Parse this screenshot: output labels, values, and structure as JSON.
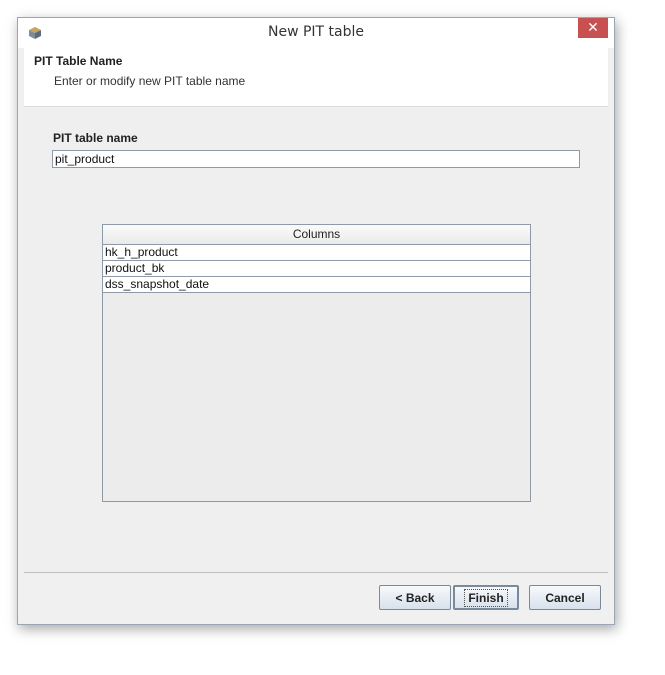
{
  "window": {
    "title": "New PIT table",
    "close_glyph": "✕",
    "app_icon": "app-cube-icon"
  },
  "header": {
    "title": "PIT Table Name",
    "subtitle": "Enter or modify new PIT table name"
  },
  "form": {
    "name_label": "PIT table name",
    "name_value": "pit_product"
  },
  "columns_table": {
    "header": "Columns",
    "rows": [
      "hk_h_product",
      "product_bk",
      "dss_snapshot_date"
    ]
  },
  "buttons": {
    "back": "< Back",
    "finish": "Finish",
    "cancel": "Cancel"
  },
  "colors": {
    "close_button": "#c75050",
    "window_bg": "#f0f0f0"
  }
}
